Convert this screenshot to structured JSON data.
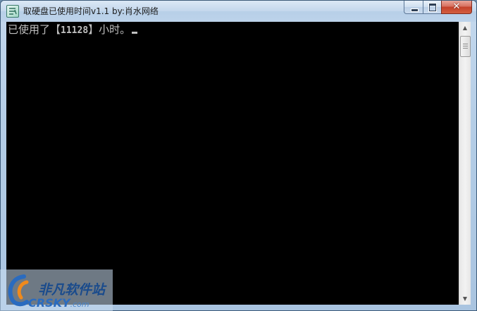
{
  "window": {
    "title": "取硬盘已使用时间v1.1 by:肖水网络",
    "minimize_icon": "minimize-icon",
    "maximize_icon": "maximize-icon",
    "close_icon": "close-icon",
    "close_glyph": "✕"
  },
  "console": {
    "prefix": "已使用了【",
    "hours": "11128",
    "suffix": "】小时。",
    "background": "#000000",
    "text_color": "#c0c0c0"
  },
  "scrollbar": {
    "up_arrow": "▲",
    "down_arrow": "▼"
  },
  "watermark": {
    "cn_text": "非凡软件站",
    "en_text": "CRSKY",
    "en_domain": ".com"
  }
}
